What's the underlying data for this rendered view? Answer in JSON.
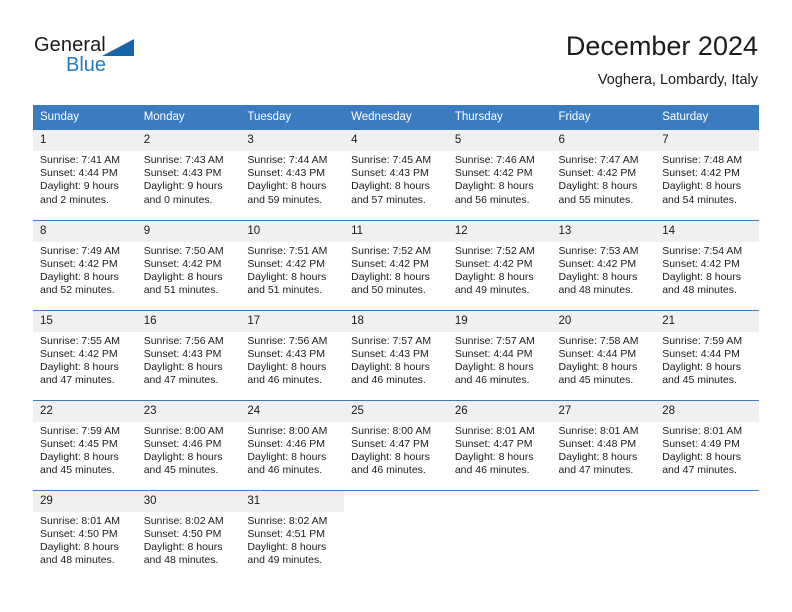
{
  "brand": {
    "name_part1": "General",
    "name_part2": "Blue",
    "accent_color": "#1f7ac2",
    "triangle_color": "#1565a8"
  },
  "header": {
    "title": "December 2024",
    "subtitle": "Voghera, Lombardy, Italy"
  },
  "calendar": {
    "header_bg": "#3b7cc0",
    "daynum_bg": "#f0f0f0",
    "weekdays": [
      "Sunday",
      "Monday",
      "Tuesday",
      "Wednesday",
      "Thursday",
      "Friday",
      "Saturday"
    ],
    "weeks": [
      [
        {
          "day": "1",
          "sunrise": "Sunrise: 7:41 AM",
          "sunset": "Sunset: 4:44 PM",
          "daylight_1": "Daylight: 9 hours",
          "daylight_2": "and 2 minutes."
        },
        {
          "day": "2",
          "sunrise": "Sunrise: 7:43 AM",
          "sunset": "Sunset: 4:43 PM",
          "daylight_1": "Daylight: 9 hours",
          "daylight_2": "and 0 minutes."
        },
        {
          "day": "3",
          "sunrise": "Sunrise: 7:44 AM",
          "sunset": "Sunset: 4:43 PM",
          "daylight_1": "Daylight: 8 hours",
          "daylight_2": "and 59 minutes."
        },
        {
          "day": "4",
          "sunrise": "Sunrise: 7:45 AM",
          "sunset": "Sunset: 4:43 PM",
          "daylight_1": "Daylight: 8 hours",
          "daylight_2": "and 57 minutes."
        },
        {
          "day": "5",
          "sunrise": "Sunrise: 7:46 AM",
          "sunset": "Sunset: 4:42 PM",
          "daylight_1": "Daylight: 8 hours",
          "daylight_2": "and 56 minutes."
        },
        {
          "day": "6",
          "sunrise": "Sunrise: 7:47 AM",
          "sunset": "Sunset: 4:42 PM",
          "daylight_1": "Daylight: 8 hours",
          "daylight_2": "and 55 minutes."
        },
        {
          "day": "7",
          "sunrise": "Sunrise: 7:48 AM",
          "sunset": "Sunset: 4:42 PM",
          "daylight_1": "Daylight: 8 hours",
          "daylight_2": "and 54 minutes."
        }
      ],
      [
        {
          "day": "8",
          "sunrise": "Sunrise: 7:49 AM",
          "sunset": "Sunset: 4:42 PM",
          "daylight_1": "Daylight: 8 hours",
          "daylight_2": "and 52 minutes."
        },
        {
          "day": "9",
          "sunrise": "Sunrise: 7:50 AM",
          "sunset": "Sunset: 4:42 PM",
          "daylight_1": "Daylight: 8 hours",
          "daylight_2": "and 51 minutes."
        },
        {
          "day": "10",
          "sunrise": "Sunrise: 7:51 AM",
          "sunset": "Sunset: 4:42 PM",
          "daylight_1": "Daylight: 8 hours",
          "daylight_2": "and 51 minutes."
        },
        {
          "day": "11",
          "sunrise": "Sunrise: 7:52 AM",
          "sunset": "Sunset: 4:42 PM",
          "daylight_1": "Daylight: 8 hours",
          "daylight_2": "and 50 minutes."
        },
        {
          "day": "12",
          "sunrise": "Sunrise: 7:52 AM",
          "sunset": "Sunset: 4:42 PM",
          "daylight_1": "Daylight: 8 hours",
          "daylight_2": "and 49 minutes."
        },
        {
          "day": "13",
          "sunrise": "Sunrise: 7:53 AM",
          "sunset": "Sunset: 4:42 PM",
          "daylight_1": "Daylight: 8 hours",
          "daylight_2": "and 48 minutes."
        },
        {
          "day": "14",
          "sunrise": "Sunrise: 7:54 AM",
          "sunset": "Sunset: 4:42 PM",
          "daylight_1": "Daylight: 8 hours",
          "daylight_2": "and 48 minutes."
        }
      ],
      [
        {
          "day": "15",
          "sunrise": "Sunrise: 7:55 AM",
          "sunset": "Sunset: 4:42 PM",
          "daylight_1": "Daylight: 8 hours",
          "daylight_2": "and 47 minutes."
        },
        {
          "day": "16",
          "sunrise": "Sunrise: 7:56 AM",
          "sunset": "Sunset: 4:43 PM",
          "daylight_1": "Daylight: 8 hours",
          "daylight_2": "and 47 minutes."
        },
        {
          "day": "17",
          "sunrise": "Sunrise: 7:56 AM",
          "sunset": "Sunset: 4:43 PM",
          "daylight_1": "Daylight: 8 hours",
          "daylight_2": "and 46 minutes."
        },
        {
          "day": "18",
          "sunrise": "Sunrise: 7:57 AM",
          "sunset": "Sunset: 4:43 PM",
          "daylight_1": "Daylight: 8 hours",
          "daylight_2": "and 46 minutes."
        },
        {
          "day": "19",
          "sunrise": "Sunrise: 7:57 AM",
          "sunset": "Sunset: 4:44 PM",
          "daylight_1": "Daylight: 8 hours",
          "daylight_2": "and 46 minutes."
        },
        {
          "day": "20",
          "sunrise": "Sunrise: 7:58 AM",
          "sunset": "Sunset: 4:44 PM",
          "daylight_1": "Daylight: 8 hours",
          "daylight_2": "and 45 minutes."
        },
        {
          "day": "21",
          "sunrise": "Sunrise: 7:59 AM",
          "sunset": "Sunset: 4:44 PM",
          "daylight_1": "Daylight: 8 hours",
          "daylight_2": "and 45 minutes."
        }
      ],
      [
        {
          "day": "22",
          "sunrise": "Sunrise: 7:59 AM",
          "sunset": "Sunset: 4:45 PM",
          "daylight_1": "Daylight: 8 hours",
          "daylight_2": "and 45 minutes."
        },
        {
          "day": "23",
          "sunrise": "Sunrise: 8:00 AM",
          "sunset": "Sunset: 4:46 PM",
          "daylight_1": "Daylight: 8 hours",
          "daylight_2": "and 45 minutes."
        },
        {
          "day": "24",
          "sunrise": "Sunrise: 8:00 AM",
          "sunset": "Sunset: 4:46 PM",
          "daylight_1": "Daylight: 8 hours",
          "daylight_2": "and 46 minutes."
        },
        {
          "day": "25",
          "sunrise": "Sunrise: 8:00 AM",
          "sunset": "Sunset: 4:47 PM",
          "daylight_1": "Daylight: 8 hours",
          "daylight_2": "and 46 minutes."
        },
        {
          "day": "26",
          "sunrise": "Sunrise: 8:01 AM",
          "sunset": "Sunset: 4:47 PM",
          "daylight_1": "Daylight: 8 hours",
          "daylight_2": "and 46 minutes."
        },
        {
          "day": "27",
          "sunrise": "Sunrise: 8:01 AM",
          "sunset": "Sunset: 4:48 PM",
          "daylight_1": "Daylight: 8 hours",
          "daylight_2": "and 47 minutes."
        },
        {
          "day": "28",
          "sunrise": "Sunrise: 8:01 AM",
          "sunset": "Sunset: 4:49 PM",
          "daylight_1": "Daylight: 8 hours",
          "daylight_2": "and 47 minutes."
        }
      ],
      [
        {
          "day": "29",
          "sunrise": "Sunrise: 8:01 AM",
          "sunset": "Sunset: 4:50 PM",
          "daylight_1": "Daylight: 8 hours",
          "daylight_2": "and 48 minutes."
        },
        {
          "day": "30",
          "sunrise": "Sunrise: 8:02 AM",
          "sunset": "Sunset: 4:50 PM",
          "daylight_1": "Daylight: 8 hours",
          "daylight_2": "and 48 minutes."
        },
        {
          "day": "31",
          "sunrise": "Sunrise: 8:02 AM",
          "sunset": "Sunset: 4:51 PM",
          "daylight_1": "Daylight: 8 hours",
          "daylight_2": "and 49 minutes."
        },
        {
          "day": "",
          "sunrise": "",
          "sunset": "",
          "daylight_1": "",
          "daylight_2": ""
        },
        {
          "day": "",
          "sunrise": "",
          "sunset": "",
          "daylight_1": "",
          "daylight_2": ""
        },
        {
          "day": "",
          "sunrise": "",
          "sunset": "",
          "daylight_1": "",
          "daylight_2": ""
        },
        {
          "day": "",
          "sunrise": "",
          "sunset": "",
          "daylight_1": "",
          "daylight_2": ""
        }
      ]
    ]
  }
}
